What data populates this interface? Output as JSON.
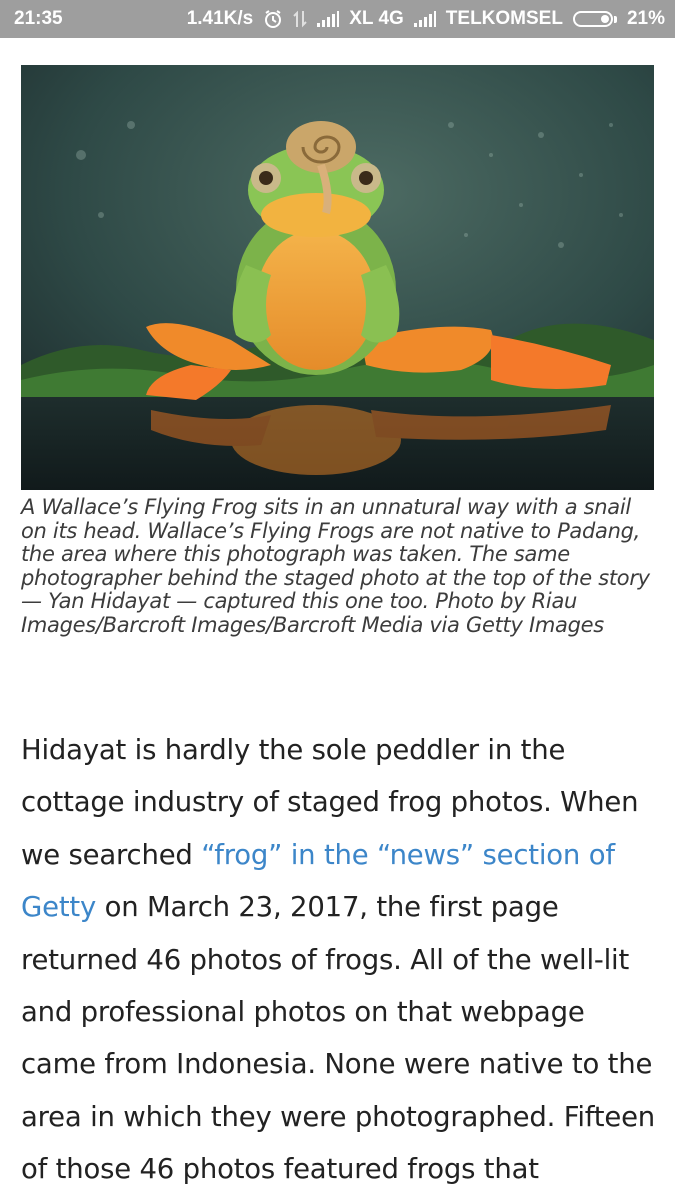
{
  "status_bar": {
    "time": "21:35",
    "network_speed": "1.41K/s",
    "carrier_1": "XL 4G",
    "carrier_2": "TELKOMSEL",
    "battery": "21%",
    "icons": [
      "alarm-icon",
      "data-arrows-icon",
      "signal-icon",
      "signal-icon",
      "battery-icon"
    ]
  },
  "article": {
    "photo_description_icon": "frog-photo",
    "caption": "A Wallace’s Flying Frog sits in an unnatural way with a snail on its head. Wallace’s Flying Frogs are not native to Padang, the area where this photograph was taken. The same photographer behind the staged photo at the top of the story — Yan Hidayat — captured this one too. Photo by Riau Images/Barcroft Images/Barcroft Media via Getty Images",
    "paragraph_before_link": "Hidayat is hardly the sole peddler in the cottage industry of staged frog photos. When we searched ",
    "link_text": "“frog” in the “news” section of Getty",
    "paragraph_after_link": " on March 23, 2017, the first page returned 46 photos of frogs. All of the well-lit and professional photos on that webpage came from Indonesia. None were native to the area in which they were photographed. Fifteen of those 46 photos featured frogs that"
  },
  "colors": {
    "status_bar_bg": "#9e9e9e",
    "link": "#3c86c9",
    "body_text": "#222222",
    "caption_text": "#3c3c3c"
  }
}
